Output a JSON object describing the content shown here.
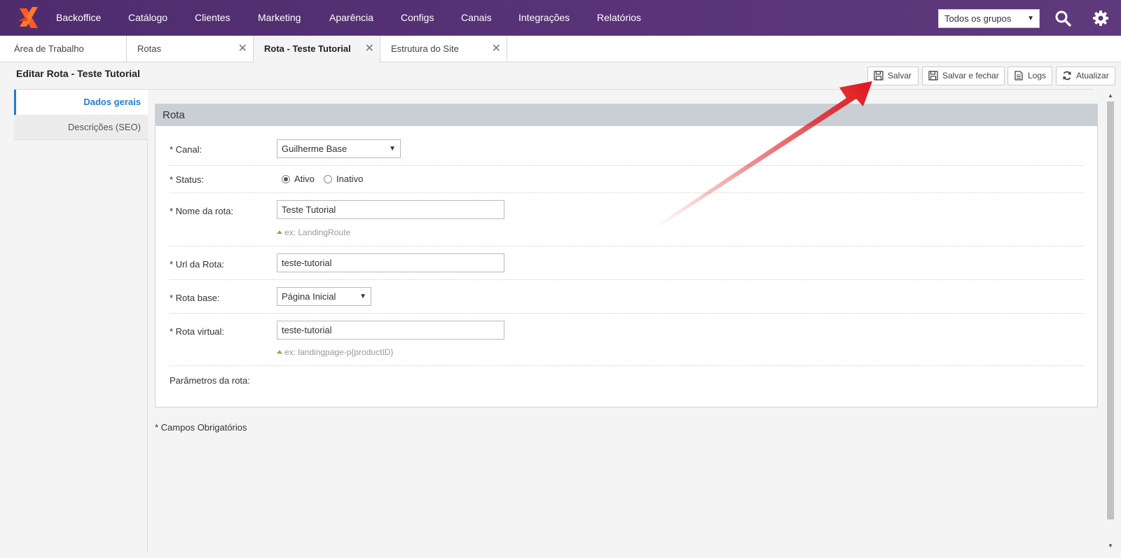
{
  "nav": {
    "items": [
      "Backoffice",
      "Catálogo",
      "Clientes",
      "Marketing",
      "Aparência",
      "Configs",
      "Canais",
      "Integrações",
      "Relatórios"
    ],
    "group_select": "Todos os grupos"
  },
  "tabs": [
    {
      "label": "Área de Trabalho",
      "closable": false
    },
    {
      "label": "Rotas",
      "closable": true
    },
    {
      "label": "Rota - Teste Tutorial",
      "closable": true,
      "active": true
    },
    {
      "label": "Estrutura do Site",
      "closable": true
    }
  ],
  "page": {
    "title": "Editar Rota - Teste Tutorial"
  },
  "toolbar": {
    "save": "Salvar",
    "save_close": "Salvar e fechar",
    "logs": "Logs",
    "refresh": "Atualizar"
  },
  "sidenav": {
    "general": "Dados gerais",
    "seo": "Descrições (SEO)"
  },
  "panel": {
    "title": "Rota",
    "canal": {
      "label": "* Canal:",
      "value": "Guilherme Base"
    },
    "status": {
      "label": "* Status:",
      "options": [
        "Ativo",
        "Inativo"
      ],
      "selected": "Ativo"
    },
    "nome": {
      "label": "* Nome da rota:",
      "value": "Teste Tutorial",
      "hint": "ex: LandingRoute"
    },
    "url": {
      "label": "* Url da Rota:",
      "value": "teste-tutorial"
    },
    "base": {
      "label": "* Rota base:",
      "value": "Página Inicial"
    },
    "virtual": {
      "label": "* Rota virtual:",
      "value": "teste-tutorial",
      "hint": "ex: landingpage-p{productID}"
    },
    "params": {
      "label": "Parâmetros da rota:"
    }
  },
  "footnote": "* Campos Obrigatórios",
  "colors": {
    "nav_bg": "#4e2c6e",
    "accent": "#1f7ed6",
    "arrow": "#e0181e"
  }
}
